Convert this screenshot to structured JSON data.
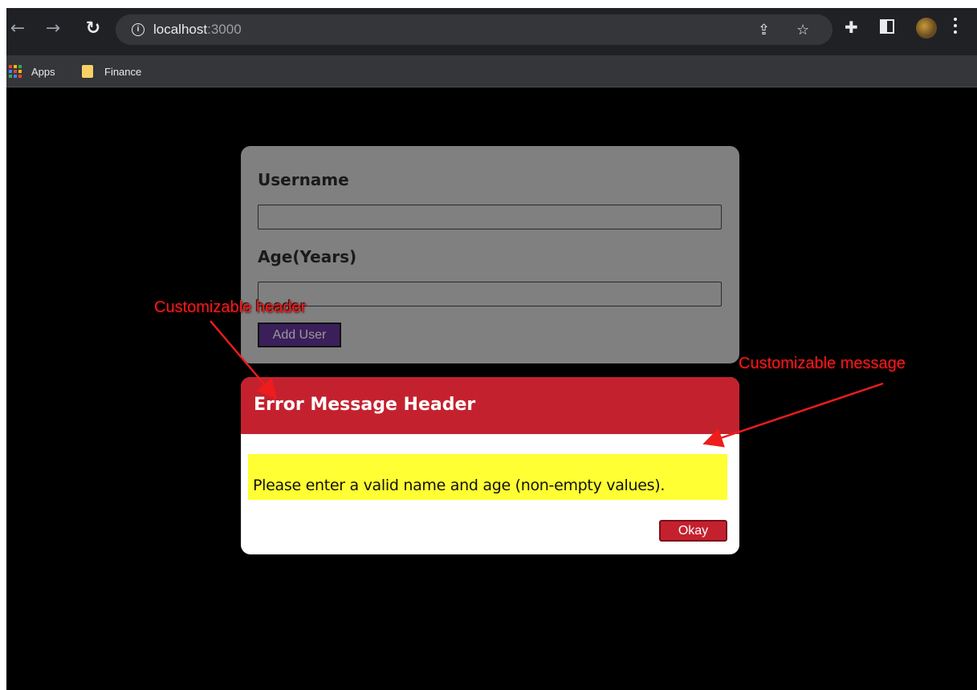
{
  "browser": {
    "url_host": "localhost",
    "url_port": ":3000",
    "nav": {
      "back_icon": "arrow-left-icon",
      "forward_icon": "arrow-right-icon",
      "reload_icon": "reload-icon"
    },
    "bookmarks": [
      {
        "label": "Apps",
        "icon": "apps-grid-icon"
      },
      {
        "label": "Finance",
        "icon": "folder-icon"
      }
    ]
  },
  "form": {
    "username_label": "Username",
    "username_value": "",
    "age_label": "Age(Years)",
    "age_value": "",
    "submit_label": "Add User"
  },
  "modal": {
    "title": "Error Message Header",
    "message": "Please enter a valid name and age (non-empty values).",
    "confirm_label": "Okay"
  },
  "annotations": {
    "header_note": "Customizable header",
    "message_note": "Customizable message"
  },
  "colors": {
    "page_bg": "#000000",
    "card_bg": "#808080",
    "header_red": "#c4212f",
    "message_highlight": "#ffff33",
    "annotation_red": "#ee1c1c",
    "button_purple": "#3b1f5a"
  }
}
